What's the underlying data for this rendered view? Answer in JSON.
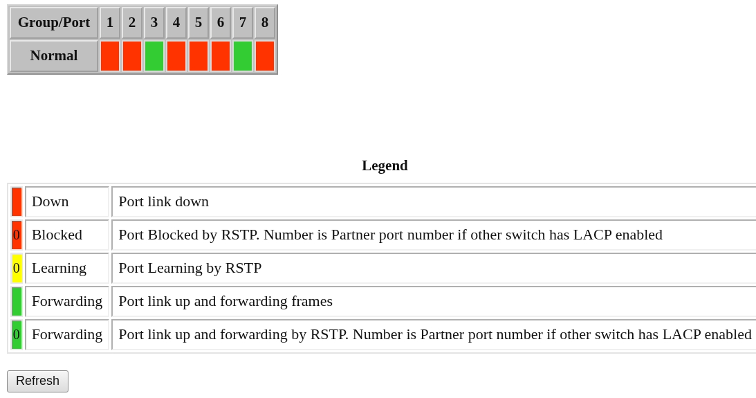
{
  "status_table": {
    "header": "Group/Port",
    "ports": [
      "1",
      "2",
      "3",
      "4",
      "5",
      "6",
      "7",
      "8"
    ],
    "rows": [
      {
        "label": "Normal",
        "ports": [
          {
            "color": "#ff3300"
          },
          {
            "color": "#ff3300"
          },
          {
            "color": "#33cc33"
          },
          {
            "color": "#ff3300"
          },
          {
            "color": "#ff3300"
          },
          {
            "color": "#ff3300"
          },
          {
            "color": "#33cc33"
          },
          {
            "color": "#ff3300"
          }
        ]
      }
    ]
  },
  "legend": {
    "title": "Legend",
    "items": [
      {
        "color": "#ff3300",
        "label": "Down",
        "description": "Port link down"
      },
      {
        "color": "#ff3300",
        "number": "0",
        "label": "Blocked",
        "description": "Port Blocked by RSTP. Number is Partner port number if other switch has LACP enabled"
      },
      {
        "color": "#ffff00",
        "number": "0",
        "label": "Learning",
        "description": "Port Learning by RSTP"
      },
      {
        "color": "#33cc33",
        "label": "Forwarding",
        "description": "Port link up and forwarding frames"
      },
      {
        "color": "#33cc33",
        "number": "0",
        "label": "Forwarding",
        "description": "Port link up and forwarding by RSTP. Number is Partner port number if other switch has LACP enabled"
      }
    ]
  },
  "refresh_button": "Refresh"
}
